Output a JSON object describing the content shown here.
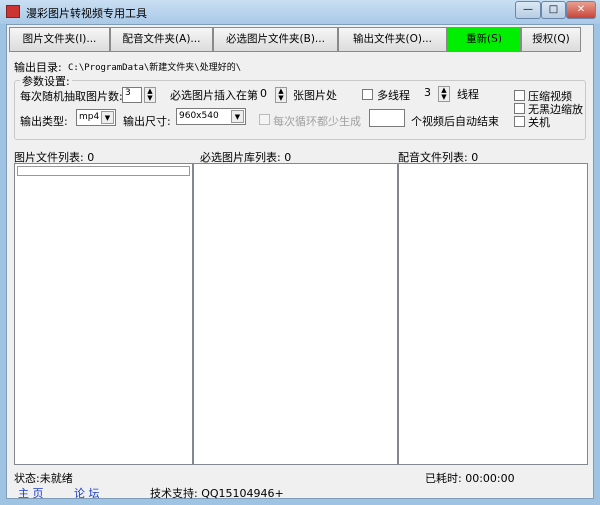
{
  "window": {
    "title": "漫彩图片转视频专用工具",
    "min": "—",
    "max": "□",
    "close": "✕"
  },
  "toolbar": {
    "buttons": [
      "图片文件夹(I)...",
      "配音文件夹(A)...",
      "必选图片文件夹(B)...",
      "输出文件夹(O)...",
      "重新(S)",
      "授权(Q)"
    ]
  },
  "output_dir": {
    "label": "输出目录:",
    "value": "C:\\ProgramData\\新建文件夹\\处理好的\\"
  },
  "params": {
    "group_label": "参数设置:",
    "random_pick_label": "每次随机抽取图片数:",
    "random_pick_value": "3",
    "insert_label": "必选图片插入在第",
    "insert_value": "0",
    "insert_suffix": "张图片处",
    "multithread_label": "多线程",
    "threads_value": "3",
    "threads_suffix": "线程",
    "compress_label": "压缩视频",
    "noborder_label": "无黑边缩放",
    "shutdown_label": "关机",
    "type_label": "输出类型:",
    "type_value": "mp4",
    "size_label": "输出尺寸:",
    "size_value": "960x540",
    "loop_label": "每次循环都少生成",
    "auto_end_value": "",
    "auto_end_suffix": "个视频后自动结束"
  },
  "lists": {
    "images_label": "图片文件列表:",
    "images_count": "0",
    "required_label": "必选图片库列表:",
    "required_count": "0",
    "audio_label": "配音文件列表:",
    "audio_count": "0"
  },
  "status": {
    "label": "状态:",
    "value": "未就绪",
    "elapsed_label": "已耗时:",
    "elapsed_value": "00:00:00"
  },
  "footer": {
    "home": "主 页",
    "forum": "论 坛",
    "support": "技术支持: QQ15104946+"
  }
}
